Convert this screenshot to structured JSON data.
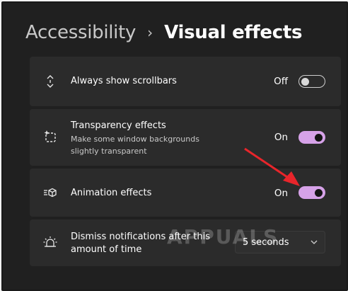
{
  "header": {
    "parent": "Accessibility",
    "separator": "›",
    "current": "Visual effects"
  },
  "settings": [
    {
      "title": "Always show scrollbars",
      "icon": "scrollbar-icon",
      "state": "Off",
      "enabled": false
    },
    {
      "title": "Transparency effects",
      "description": "Make some window backgrounds slightly transparent",
      "icon": "transparency-icon",
      "state": "On",
      "enabled": true
    },
    {
      "title": "Animation effects",
      "icon": "animation-icon",
      "state": "On",
      "enabled": true
    },
    {
      "title": "Dismiss notifications after this amount of time",
      "icon": "notification-icon",
      "dropdown_value": "5 seconds"
    }
  ],
  "colors": {
    "background": "#202020",
    "card": "#2b2b2b",
    "toggle_on": "#d6a2e8",
    "annotation_arrow": "#e8252b"
  },
  "watermark": "APPUALS"
}
